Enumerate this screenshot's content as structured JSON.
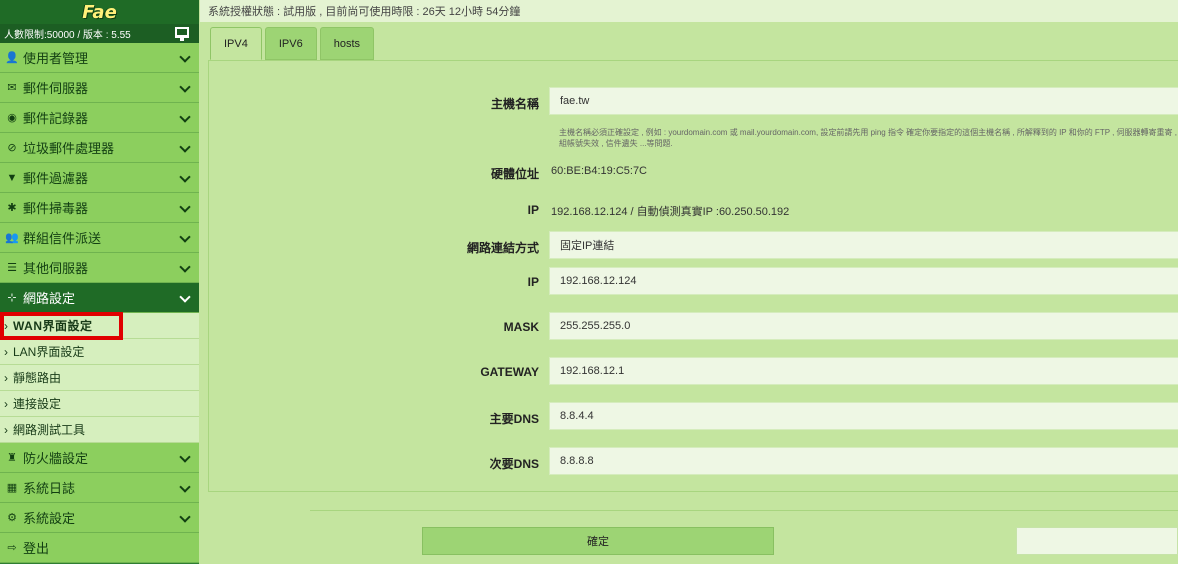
{
  "sidebar": {
    "logo": "Fae",
    "info": "人數限制:50000 / 版本 : 5.55",
    "menu": [
      {
        "label": "使用者管理",
        "icon": "user-icon",
        "glyph": "👤"
      },
      {
        "label": "郵件伺服器",
        "icon": "envelope-icon",
        "glyph": "✉"
      },
      {
        "label": "郵件記錄器",
        "icon": "camera-icon",
        "glyph": "◉"
      },
      {
        "label": "垃圾郵件處理器",
        "icon": "ban-icon",
        "glyph": "⊘"
      },
      {
        "label": "郵件過濾器",
        "icon": "filter-icon",
        "glyph": "▼"
      },
      {
        "label": "郵件掃毒器",
        "icon": "bug-icon",
        "glyph": "✱"
      },
      {
        "label": "群組信件派送",
        "icon": "users-icon",
        "glyph": "👥"
      },
      {
        "label": "其他伺服器",
        "icon": "server-icon",
        "glyph": "☰"
      },
      {
        "label": "網路設定",
        "icon": "network-icon",
        "glyph": "⊹"
      }
    ],
    "submenu": [
      {
        "label": "WAN界面設定"
      },
      {
        "label": "LAN界面設定"
      },
      {
        "label": "靜態路由"
      },
      {
        "label": "連接設定"
      },
      {
        "label": "網路測試工具"
      }
    ],
    "menu_bottom": [
      {
        "label": "防火牆設定",
        "icon": "firewall-icon",
        "glyph": "♜"
      },
      {
        "label": "系統日誌",
        "icon": "calendar-icon",
        "glyph": "▦"
      },
      {
        "label": "系統設定",
        "icon": "gears-icon",
        "glyph": "⚙"
      },
      {
        "label": "登出",
        "icon": "logout-icon",
        "glyph": "⇨"
      }
    ]
  },
  "status": "系統授權狀態 : 試用版 , 目前尚可使用時限 : 26天 12小時 54分鐘",
  "tabs": [
    "IPV4",
    "IPV6",
    "hosts"
  ],
  "form": {
    "hostname_label": "主機名稱",
    "hostname_value": "fae.tw",
    "hostname_hint": "主機名稱必須正確設定 , 例如 : yourdomain.com 或 mail.yourdomain.com, 設定前請先用 ping 指令 確定你要指定的這個主機名稱 , 所解釋到的 IP 和你的 FTP , 伺服器轉寄重寄 , 群組帳號失效 , 信件遺失 ...等問題.",
    "mac_label": "硬體位址",
    "mac_value": "60:BE:B4:19:C5:7C",
    "ip_info_label": "IP",
    "ip_info_value": "192.168.12.124 / 自動偵測真實IP :60.250.50.192",
    "conn_label": "網路連結方式",
    "conn_value": "固定IP連結",
    "ip_label": "IP",
    "ip_value": "192.168.12.124",
    "mask_label": "MASK",
    "mask_value": "255.255.255.0",
    "gateway_label": "GATEWAY",
    "gateway_value": "192.168.12.1",
    "dns1_label": "主要DNS",
    "dns1_value": "8.8.4.4",
    "dns2_label": "次要DNS",
    "dns2_value": "8.8.8.8"
  },
  "buttons": {
    "confirm": "確定"
  }
}
